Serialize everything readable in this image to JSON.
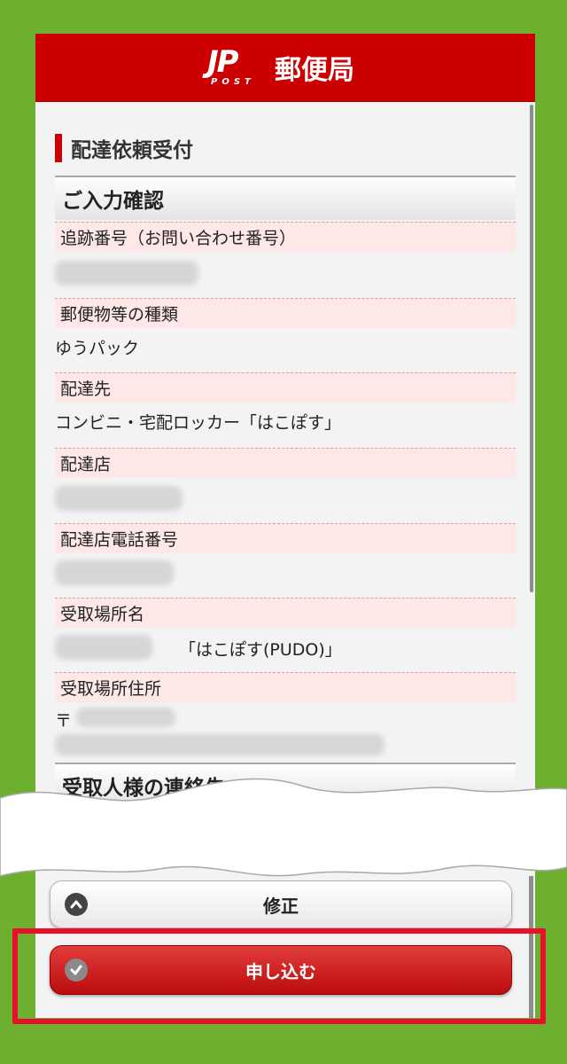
{
  "app": {
    "logo_mark": "JP",
    "logo_sub": "POST",
    "title": "郵便局"
  },
  "page": {
    "section_title": "配達依頼受付",
    "confirm_heading": "ご入力確認"
  },
  "fields": [
    {
      "label": "追跡番号（お問い合わせ番号）",
      "value": ""
    },
    {
      "label": "郵便物等の種類",
      "value": "ゆうパック"
    },
    {
      "label": "配達先",
      "value": "コンビニ・宅配ロッカー「はこぽす」"
    },
    {
      "label": "配達店",
      "value": ""
    },
    {
      "label": "配達店電話番号",
      "value": ""
    },
    {
      "label": "受取場所名",
      "value": "「はこぽす(PUDO)」"
    },
    {
      "label": "受取場所住所",
      "value": "〒"
    }
  ],
  "contact_heading": "受取人様の連絡先",
  "buttons": {
    "fix": "修正",
    "apply": "申し込む"
  },
  "icons": {
    "fix": "chevron-up-icon",
    "apply": "check-icon"
  },
  "colors": {
    "brand_red": "#cc0000",
    "background_green": "#6db02f",
    "highlight_red": "#e8102a"
  }
}
